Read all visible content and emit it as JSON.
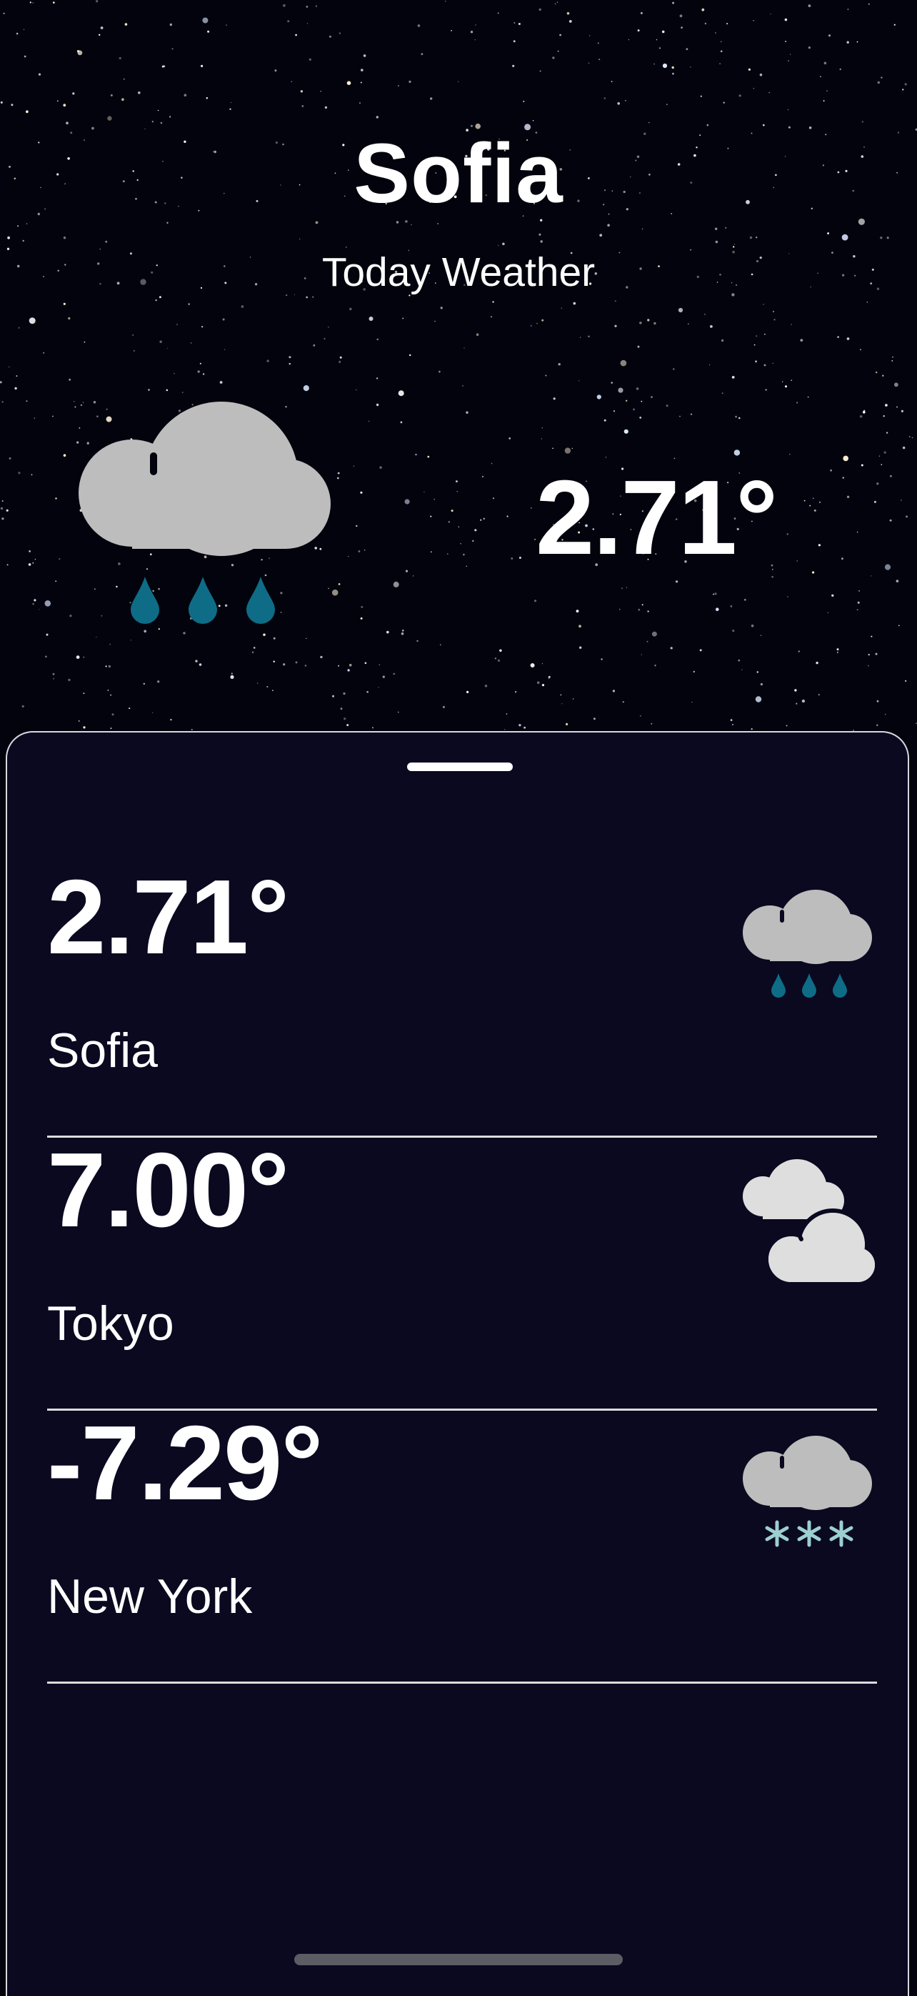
{
  "header": {
    "city": "Sofia",
    "subtitle": "Today Weather",
    "temperature": "2.71°",
    "condition_icon": "rain-icon"
  },
  "cities": [
    {
      "temperature": "2.71°",
      "name": "Sofia",
      "icon": "rain-icon"
    },
    {
      "temperature": "7.00°",
      "name": "Tokyo",
      "icon": "cloudy-icon"
    },
    {
      "temperature": "-7.29°",
      "name": "New York",
      "icon": "snow-icon"
    }
  ],
  "colors": {
    "sheet_background": "#0a0920",
    "cloud": "#bdbdbd",
    "raindrop": "#0e6c86",
    "snowflake": "#9ccfd0"
  }
}
